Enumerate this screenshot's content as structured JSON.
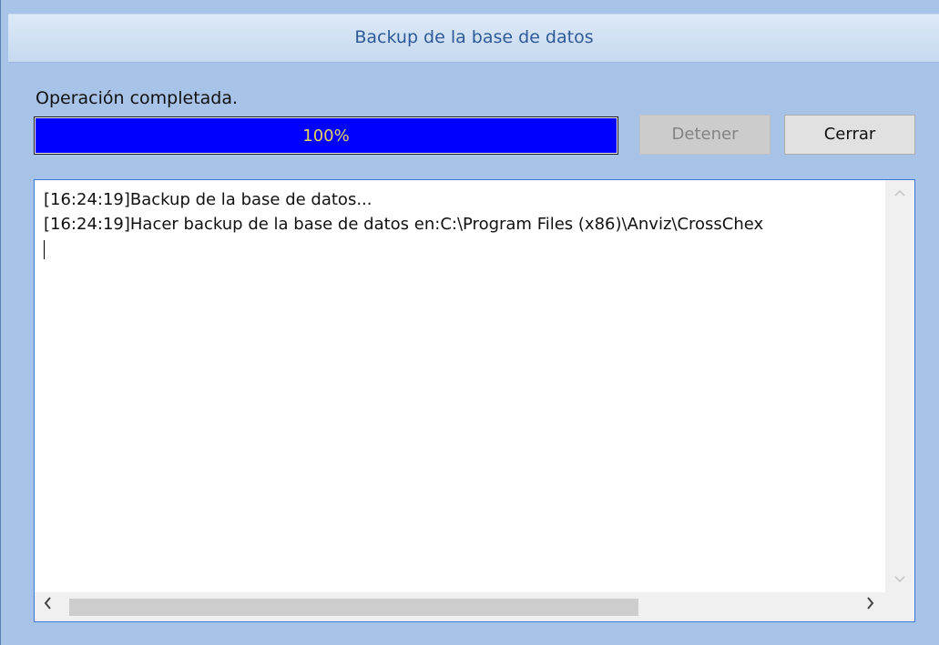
{
  "window": {
    "title": "Backup de la base de datos"
  },
  "status": {
    "label": "Operación completada."
  },
  "progress": {
    "value": 1.0,
    "text": "100%",
    "fill_color": "#0000ff",
    "text_color": "#e6d35a"
  },
  "buttons": {
    "stop_label": "Detener",
    "close_label": "Cerrar"
  },
  "log": {
    "lines": [
      "[16:24:19]Backup de la base de datos...",
      "[16:24:19]Hacer backup de la base de datos en:C:\\Program Files (x86)\\Anviz\\CrossChex"
    ]
  },
  "scrollbars": {
    "up_icon": "chevron-up-icon",
    "down_icon": "chevron-down-icon",
    "left_icon": "chevron-left-icon",
    "right_icon": "chevron-right-icon"
  }
}
